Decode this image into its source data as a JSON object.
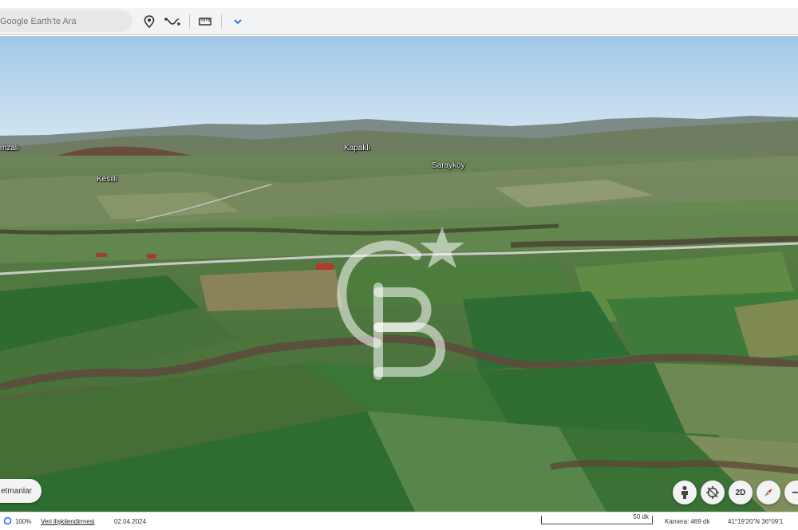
{
  "toolbar": {
    "search_placeholder": "Google Earth'te Ara",
    "icons": [
      "location-pin-icon",
      "path-icon",
      "ruler-icon",
      "chevron-down-icon"
    ]
  },
  "map": {
    "labels": {
      "left_edge": "mzalı",
      "kesilli": "Kesilli",
      "kapakli": "Kapaklı",
      "saraykoy": "Sarayköy"
    },
    "watermark": "CB"
  },
  "bottom_left_chip": "etmanlar",
  "controls": {
    "pegman": "pegman-icon",
    "compass_reset": "reset-view-icon",
    "mode_2d": "2D",
    "compass": "compass-icon"
  },
  "status_bar": {
    "zoom": "100%",
    "data_attribution": "Veri ilişkilendirmesi",
    "date": "02.04.2024",
    "scale": "50 dk",
    "camera": "Kamera: 469 dk",
    "coords": "41°19'20\"N 36°09'1"
  },
  "colors": {
    "sky_top": "#a9cdea",
    "sky_bottom": "#cfe3f1",
    "field_green": "#3e6e34",
    "accent_blue": "#1a73e8"
  }
}
